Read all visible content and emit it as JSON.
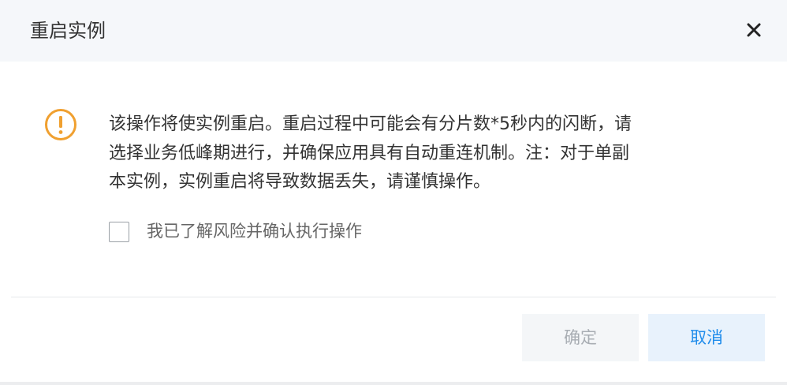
{
  "dialog": {
    "title": "重启实例",
    "close_icon": "close-icon",
    "warning_icon": "exclamation-circle-icon",
    "warning_color": "#f0a030",
    "message_lines": [
      "该操作将使实例重启。重启过程中可能会有分片数*5秒内的闪断，请",
      "选择业务低峰期进行，并确保应用具有自动重连机制。注：对于单副",
      "本实例，实例重启将导致数据丢失，请谨慎操作。"
    ],
    "confirm_checkbox": {
      "label": "我已了解风险并确认执行操作",
      "checked": false
    },
    "buttons": {
      "ok_label": "确定",
      "ok_enabled": false,
      "cancel_label": "取消"
    },
    "colors": {
      "header_bg": "#f5f7fa",
      "primary_text": "#333333",
      "link_blue": "#1f8ceb",
      "cancel_bg": "#e8f2fc",
      "disabled_bg": "#f4f6f8",
      "disabled_text": "#a8adb3"
    }
  }
}
